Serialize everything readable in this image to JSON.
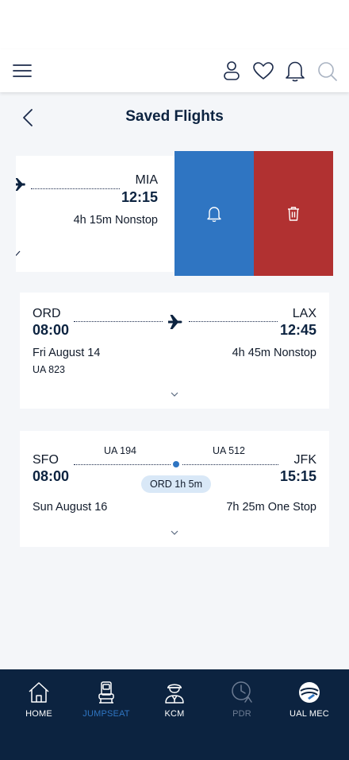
{
  "header": {
    "title": "Saved Flights"
  },
  "flights": [
    {
      "arrival_code": "MIA",
      "arrival_time": "12:15",
      "duration": "4h 15m Nonstop",
      "actions": {
        "alert": "bell-icon",
        "delete": "trash-icon"
      },
      "colors": {
        "alert": "#2f75c2",
        "delete": "#b13131"
      }
    },
    {
      "departure_code": "ORD",
      "departure_time": "08:00",
      "arrival_code": "LAX",
      "arrival_time": "12:45",
      "date": "Fri August 14",
      "duration": "4h 45m Nonstop",
      "flight_number": "UA 823"
    },
    {
      "departure_code": "SFO",
      "departure_time": "08:00",
      "arrival_code": "JFK",
      "arrival_time": "15:15",
      "segment1": "UA 194",
      "segment2": "UA 512",
      "layover": "ORD 1h 5m",
      "date": "Sun August 16",
      "duration": "7h 25m One Stop"
    }
  ],
  "bottom_nav": [
    {
      "label": "HOME",
      "icon": "home-icon",
      "state": "normal"
    },
    {
      "label": "JUMPSEAT",
      "icon": "seat-icon",
      "state": "active"
    },
    {
      "label": "KCM",
      "icon": "pilot-icon",
      "state": "normal"
    },
    {
      "label": "PDR",
      "icon": "clock-icon",
      "state": "disabled"
    },
    {
      "label": "UAL MEC",
      "icon": "globe-logo-icon",
      "state": "normal"
    }
  ],
  "theme": {
    "navy": "#0c2340",
    "blue": "#2f75c2",
    "red": "#b13131",
    "background": "#f4f6f9"
  }
}
